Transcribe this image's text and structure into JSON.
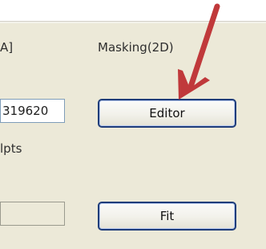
{
  "labels": {
    "unit_partial": "A]",
    "masking": "Masking(2D)",
    "pts_partial": "lpts"
  },
  "fields": {
    "value_partial": "319620",
    "empty_field": ""
  },
  "buttons": {
    "editor": "Editor",
    "fit": "Fit"
  },
  "annotation": {
    "arrow_color": "#c0393b"
  }
}
